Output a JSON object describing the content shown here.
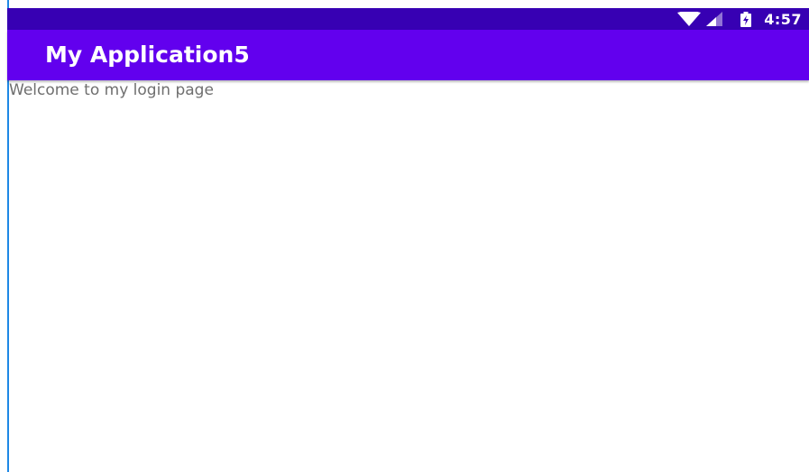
{
  "status_bar": {
    "time": "4:57",
    "icons": [
      "wifi-icon",
      "signal-icon",
      "battery-charging-icon"
    ]
  },
  "app_bar": {
    "title": "My Application5"
  },
  "main": {
    "welcome_text": "Welcome to my login page"
  },
  "colors": {
    "status_bar": "#3700b3",
    "app_bar": "#6200ee",
    "text_secondary": "#6f6f6f"
  }
}
